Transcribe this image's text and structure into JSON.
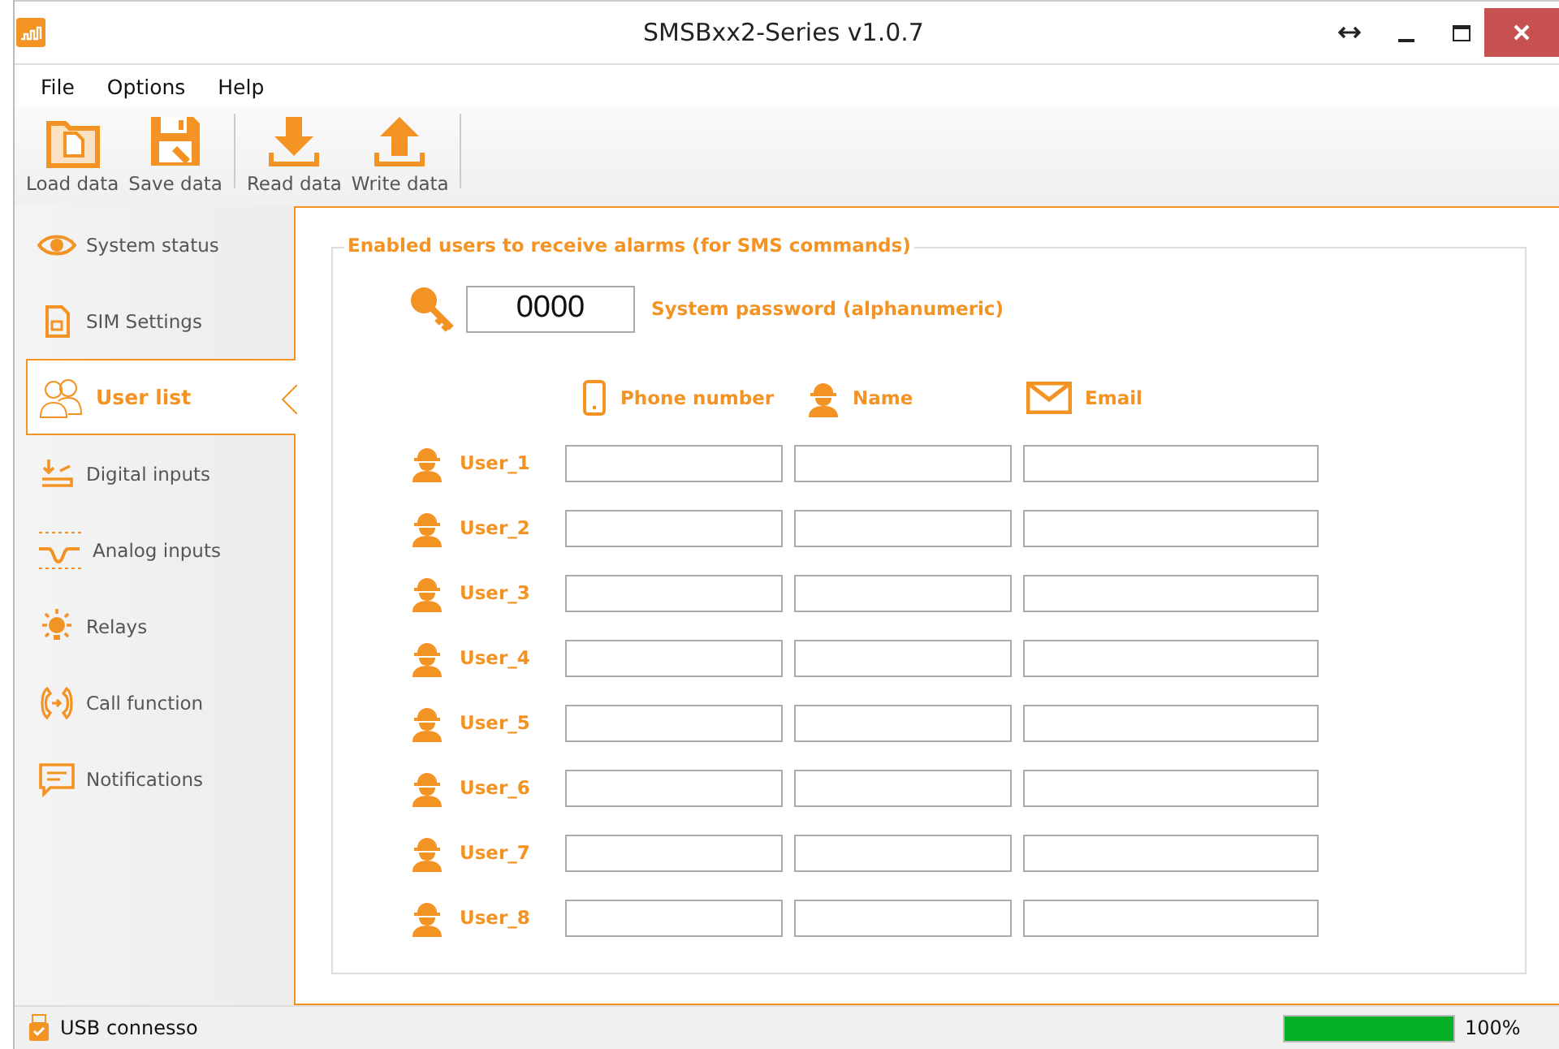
{
  "window": {
    "title": "SMSBxx2-Series v1.0.7"
  },
  "menu": [
    "File",
    "Options",
    "Help"
  ],
  "toolbar": [
    {
      "label": "Load data",
      "kind": "folder"
    },
    {
      "label": "Save data",
      "kind": "save"
    },
    {
      "label": "Read data",
      "kind": "download"
    },
    {
      "label": "Write data",
      "kind": "upload"
    }
  ],
  "sidebar": {
    "items": [
      {
        "label": "System status",
        "kind": "eye",
        "selected": false
      },
      {
        "label": "SIM Settings",
        "kind": "sim",
        "selected": false
      },
      {
        "label": "User list",
        "kind": "users",
        "selected": true
      },
      {
        "label": "Digital inputs",
        "kind": "digital",
        "selected": false
      },
      {
        "label": "Analog inputs",
        "kind": "analog",
        "selected": false
      },
      {
        "label": "Relays",
        "kind": "bulb",
        "selected": false
      },
      {
        "label": "Call function",
        "kind": "call",
        "selected": false
      },
      {
        "label": "Notifications",
        "kind": "chat",
        "selected": false
      }
    ]
  },
  "group": {
    "title": "Enabled users to receive alarms (for SMS commands)",
    "password": {
      "value": "0000",
      "label": "System password (alphanumeric)"
    },
    "columns": [
      {
        "label": "Phone number",
        "kind": "phone"
      },
      {
        "label": "Name",
        "kind": "user"
      },
      {
        "label": "Email",
        "kind": "mail"
      }
    ],
    "users": [
      "User_1",
      "User_2",
      "User_3",
      "User_4",
      "User_5",
      "User_6",
      "User_7",
      "User_8"
    ]
  },
  "status_bar": {
    "text": "USB connesso",
    "level": 1,
    "reading": "100%"
  }
}
